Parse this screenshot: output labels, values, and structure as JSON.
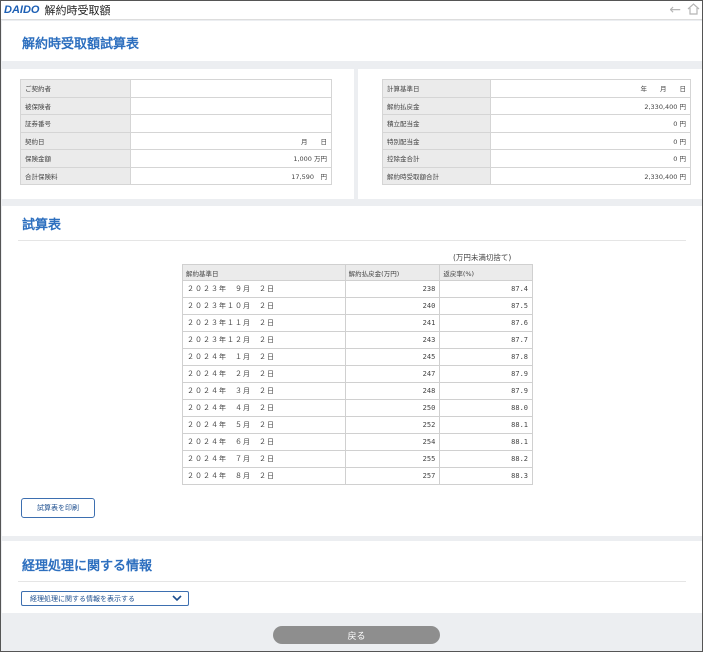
{
  "app": {
    "logo": "DAIDO",
    "title": "解約時受取額"
  },
  "page_title": "解約時受取額試算表",
  "contract": [
    {
      "label": "ご契約者",
      "value": ""
    },
    {
      "label": "被保険者",
      "value": ""
    },
    {
      "label": "証券番号",
      "value": ""
    },
    {
      "label": "契約日",
      "value": "月　　日"
    },
    {
      "label": "保険金額",
      "value": "1,000 万円"
    },
    {
      "label": "合計保険料",
      "value": "17,590　円"
    }
  ],
  "calc": [
    {
      "label": "計算基準日",
      "value": "年　　月　　日"
    },
    {
      "label": "解約払戻金",
      "value": "2,330,400 円"
    },
    {
      "label": "積立配当金",
      "value": "0 円"
    },
    {
      "label": "特別配当金",
      "value": "0 円"
    },
    {
      "label": "控除金合計",
      "value": "0 円"
    },
    {
      "label": "解約時受取額合計",
      "value": "2,330,400 円"
    }
  ],
  "result_section_title": "試算表",
  "result_note": "(万円未満切捨て)",
  "result_headers": [
    "解約基準日",
    "解約払戻金(万円)",
    "返戻率(%)"
  ],
  "result_rows": [
    [
      "２０２３年　９月　２日",
      "238",
      "87.4"
    ],
    [
      "２０２３年１０月　２日",
      "240",
      "87.5"
    ],
    [
      "２０２３年１１月　２日",
      "241",
      "87.6"
    ],
    [
      "２０２３年１２月　２日",
      "243",
      "87.7"
    ],
    [
      "２０２４年　１月　２日",
      "245",
      "87.8"
    ],
    [
      "２０２４年　２月　２日",
      "247",
      "87.9"
    ],
    [
      "２０２４年　３月　２日",
      "248",
      "87.9"
    ],
    [
      "２０２４年　４月　２日",
      "250",
      "88.0"
    ],
    [
      "２０２４年　５月　２日",
      "252",
      "88.1"
    ],
    [
      "２０２４年　６月　２日",
      "254",
      "88.1"
    ],
    [
      "２０２４年　７月　２日",
      "255",
      "88.2"
    ],
    [
      "２０２４年　８月　２日",
      "257",
      "88.3"
    ]
  ],
  "print_button": "試算表を印刷",
  "accounting_title": "経理処理に関する情報",
  "accounting_dropdown": "経理処理に関する情報を表示する",
  "back_button": "戻る",
  "icons": {
    "back": "arrow-left-icon",
    "home": "home-icon",
    "chevron": "chevron-down-icon"
  }
}
